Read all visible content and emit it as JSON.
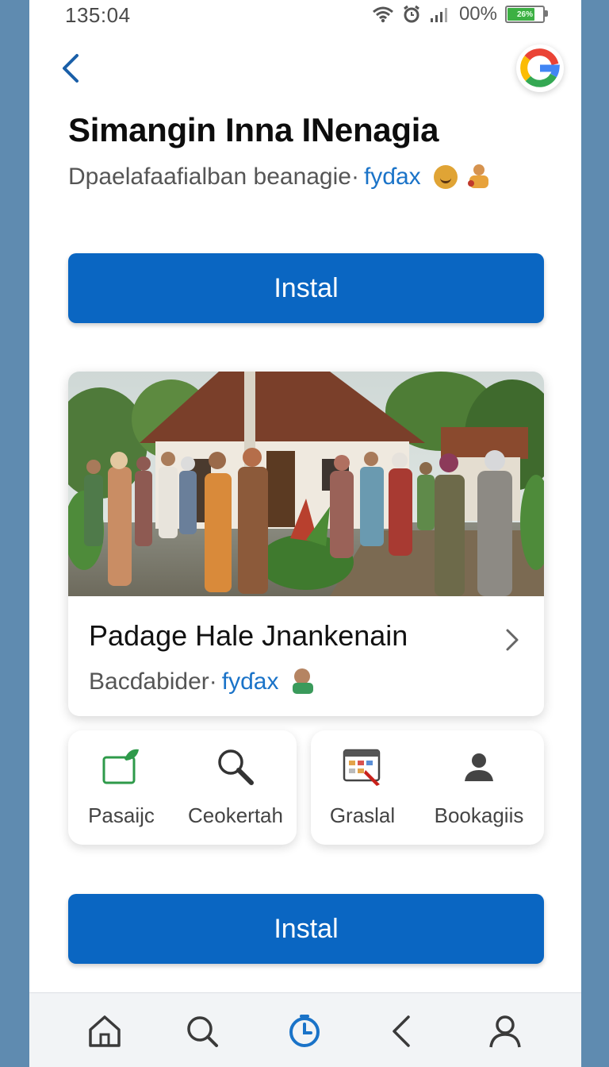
{
  "status_bar": {
    "time": "135:04",
    "battery_text": "00%",
    "battery_icon_text": "26%"
  },
  "header": {
    "title": "Simangin Inna INenagia",
    "subtitle": "Dpaelafaafialban beanagie·",
    "subtitle_link": "fyɗax"
  },
  "install_top": {
    "label": "Instal"
  },
  "card": {
    "title": "Padage Hale Jnankenain",
    "meta": "Bacɗabider·",
    "meta_link": "fyɗax"
  },
  "tiles": [
    {
      "label": "Pasaijc",
      "icon": "folder-leaf-icon"
    },
    {
      "label": "Ceokertah",
      "icon": "magnifier-icon"
    },
    {
      "label": "Graslal",
      "icon": "calendar-pen-icon"
    },
    {
      "label": "Bookagiis",
      "icon": "person-icon"
    }
  ],
  "install_bottom": {
    "label": "Instal"
  },
  "nav": [
    "home-icon",
    "search-icon",
    "clock-icon",
    "back-icon",
    "profile-icon"
  ],
  "colors": {
    "accent": "#0a66c2",
    "link": "#1a73c8",
    "frame": "#5f8bb0",
    "active_nav": "#1a73c8"
  }
}
